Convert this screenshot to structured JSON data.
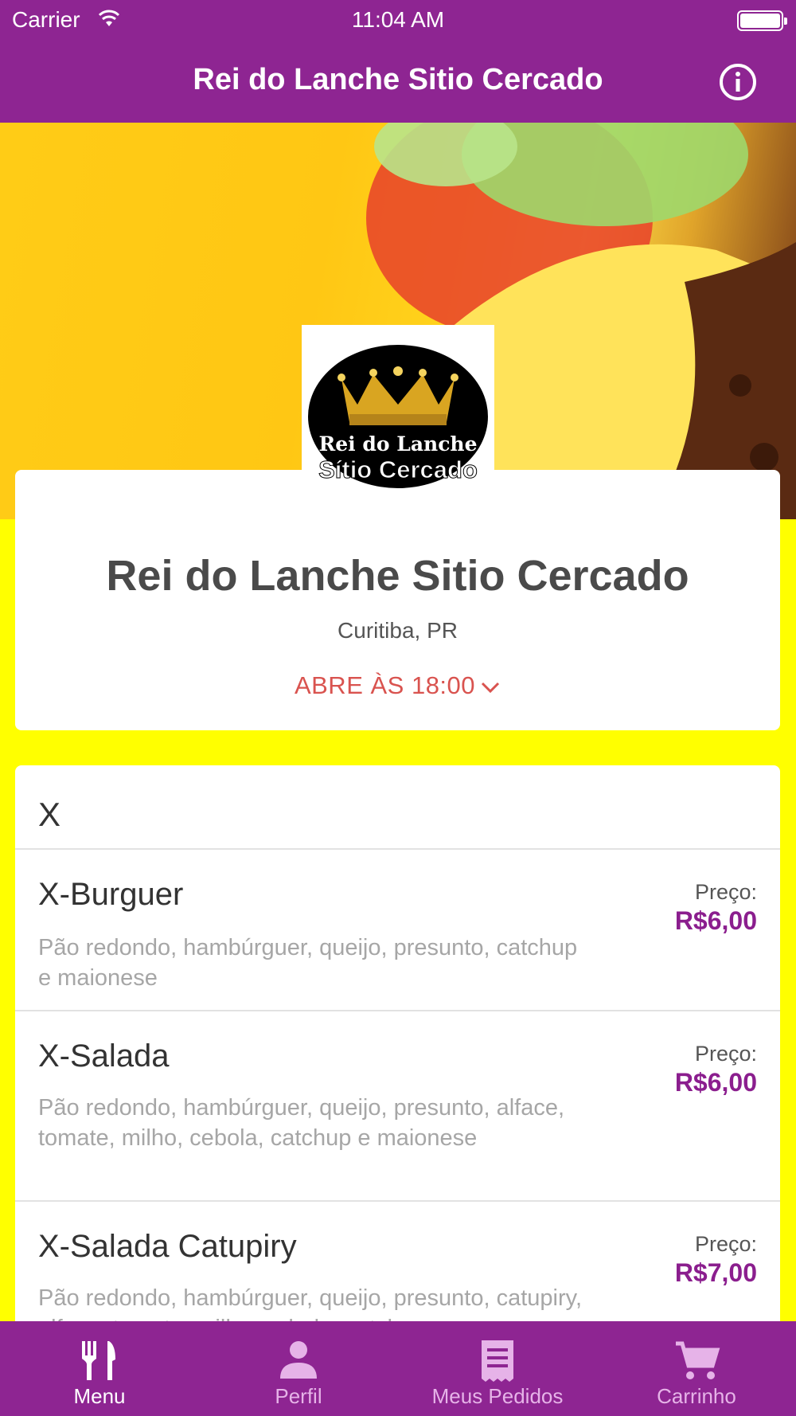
{
  "status_bar": {
    "carrier": "Carrier",
    "time": "11:04 AM"
  },
  "nav": {
    "title": "Rei do Lanche Sitio Cercado",
    "info_icon": "info-icon"
  },
  "logo": {
    "line1": "Rei do Lanche",
    "line2": "Sítio Cercado"
  },
  "restaurant": {
    "name": "Rei do Lanche Sitio Cercado",
    "city": "Curitiba, PR",
    "opens": "ABRE ÀS 18:00"
  },
  "menu": {
    "section": "X",
    "items": [
      {
        "name": "X-Burguer",
        "desc": "Pão redondo, hambúrguer, queijo, presunto, catchup e maionese",
        "price_label": "Preço:",
        "price": "R$6,00"
      },
      {
        "name": "X-Salada",
        "desc": "Pão redondo, hambúrguer, queijo, presunto, alface, tomate, milho, cebola, catchup e maionese",
        "price_label": "Preço:",
        "price": "R$6,00"
      },
      {
        "name": "X-Salada Catupiry",
        "desc": "Pão redondo, hambúrguer, queijo, presunto, catupiry, alface, tomate, milho, cebola, catchup e",
        "price_label": "Preço:",
        "price": "R$7,00"
      }
    ]
  },
  "tabs": [
    {
      "label": "Menu",
      "icon": "fork-knife-icon",
      "active": true
    },
    {
      "label": "Perfil",
      "icon": "person-icon"
    },
    {
      "label": "Meus Pedidos",
      "icon": "receipt-icon"
    },
    {
      "label": "Carrinho",
      "icon": "cart-icon"
    }
  ],
  "colors": {
    "primary": "#8e2592",
    "background": "#ffff00",
    "price": "#8b1e8e",
    "opens": "#d9534f"
  }
}
